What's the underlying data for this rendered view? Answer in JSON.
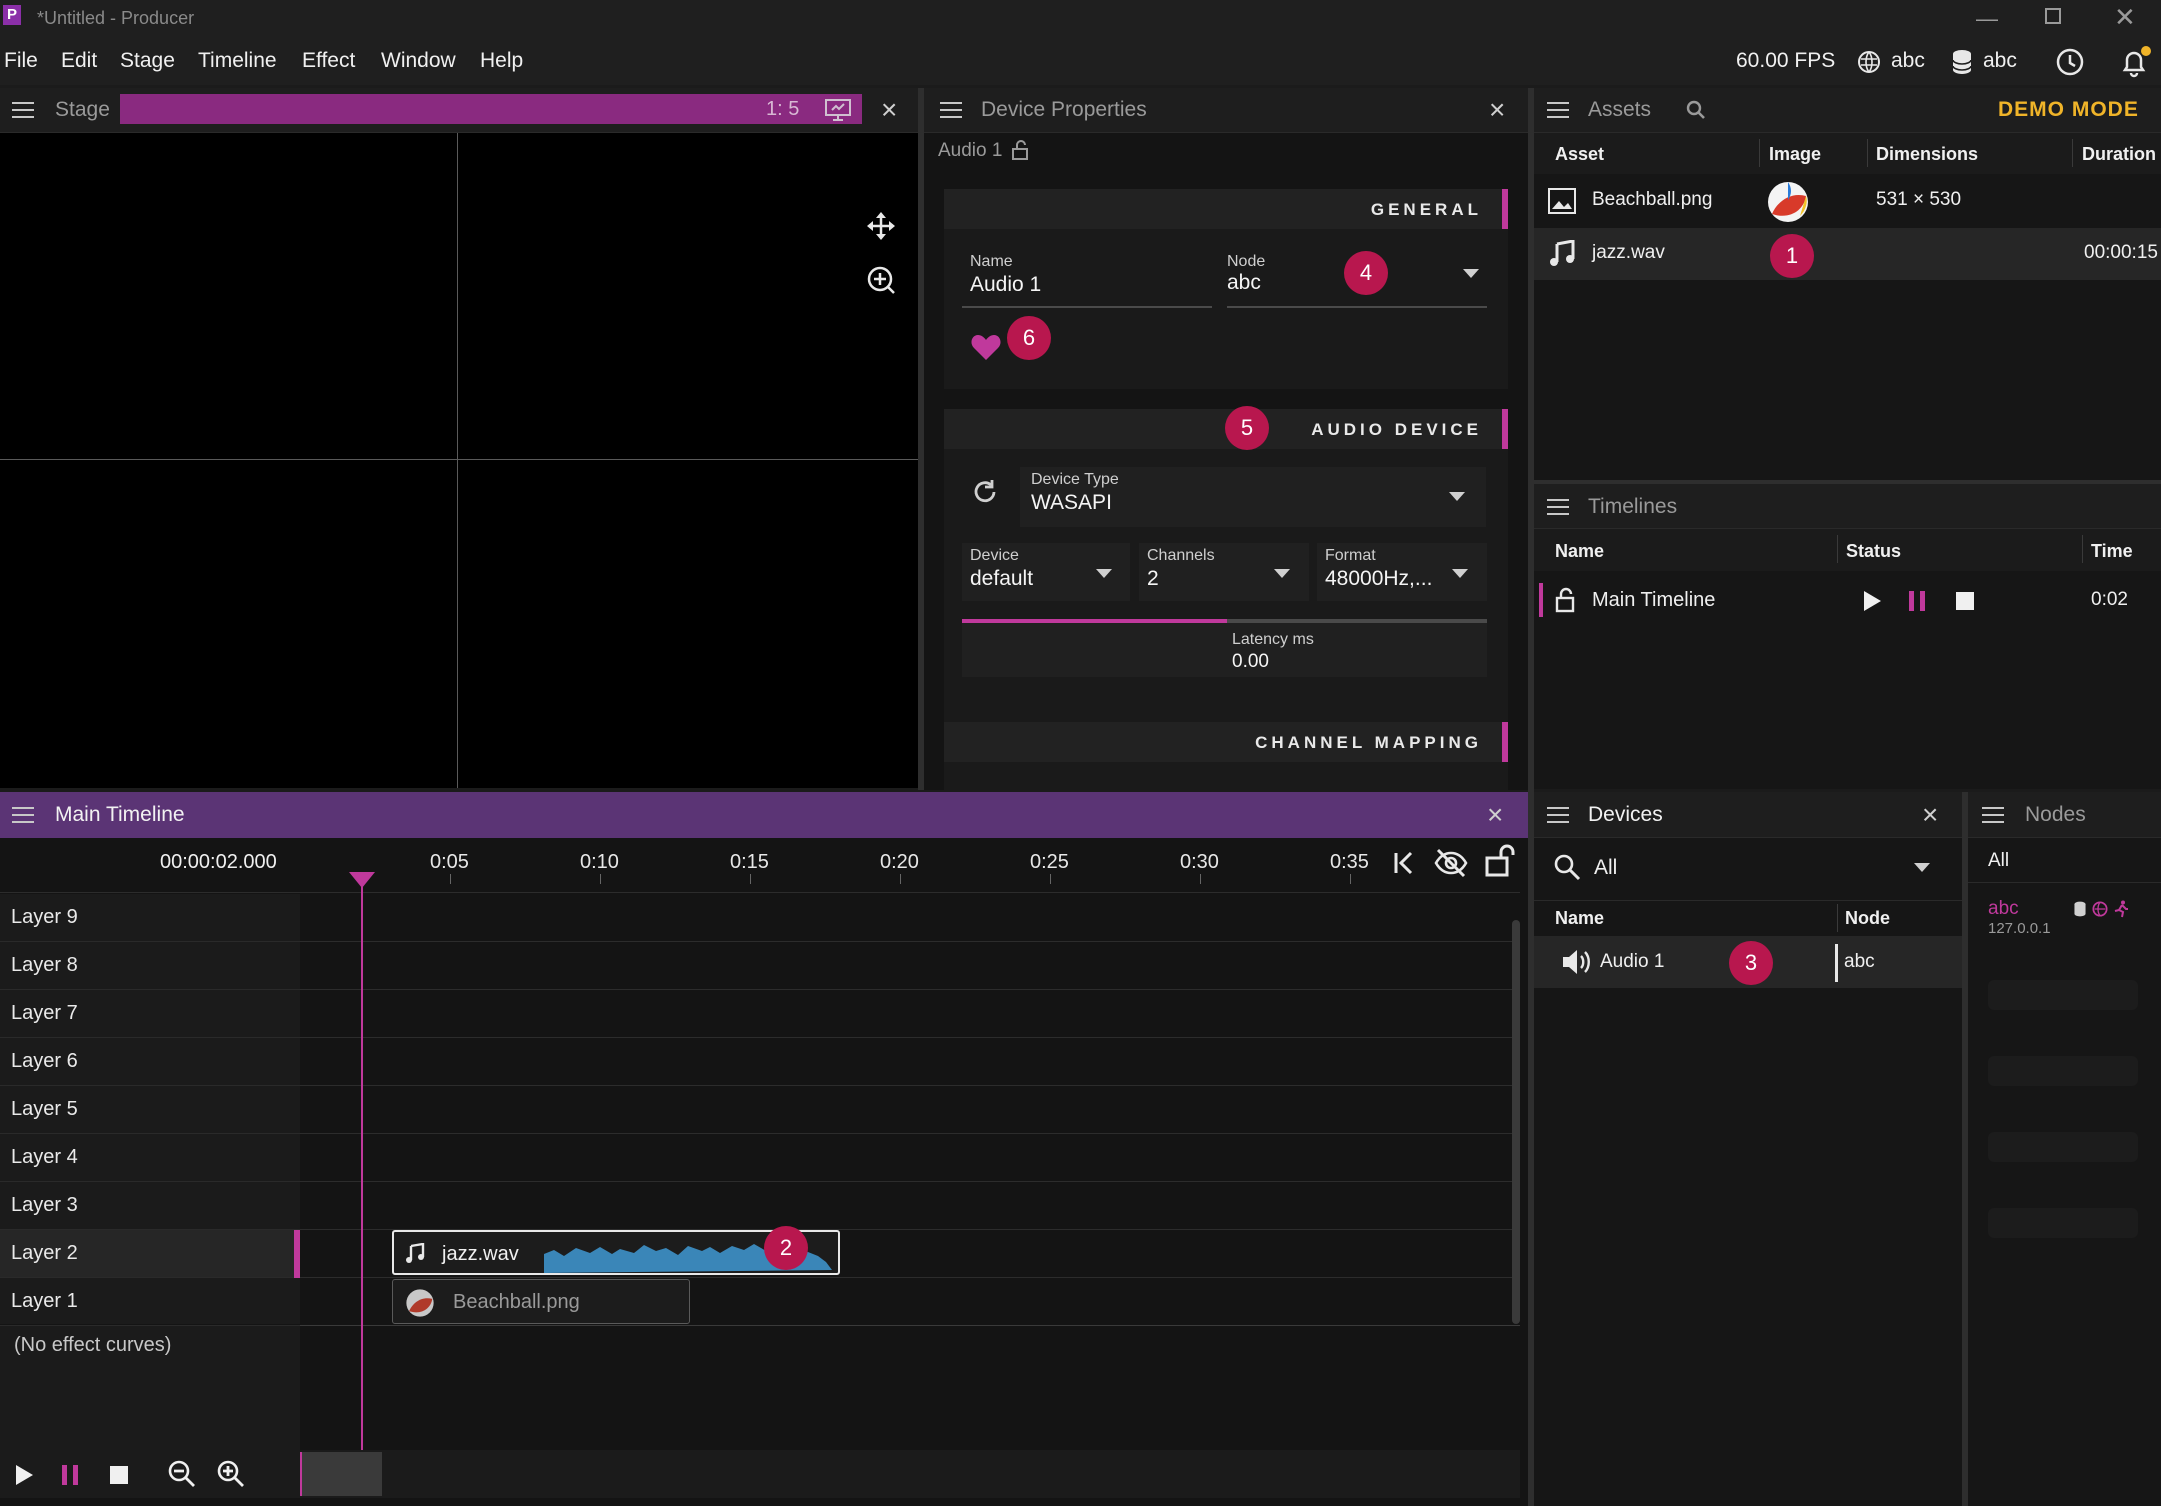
{
  "window": {
    "app_icon_letter": "P",
    "title": "*Untitled - Producer"
  },
  "menu": [
    "File",
    "Edit",
    "Stage",
    "Timeline",
    "Effect",
    "Window",
    "Help"
  ],
  "status": {
    "fps": "60.00 FPS",
    "net_node": "abc",
    "db_node": "abc"
  },
  "stage": {
    "title": "Stage",
    "ratio": "1: 5"
  },
  "device_properties": {
    "title": "Device Properties",
    "breadcrumb": "Audio 1",
    "general": {
      "header": "GENERAL",
      "name_label": "Name",
      "name_value": "Audio 1",
      "node_label": "Node",
      "node_value": "abc"
    },
    "audio_device": {
      "header": "AUDIO DEVICE",
      "device_type_label": "Device Type",
      "device_type_value": "WASAPI",
      "device_label": "Device",
      "device_value": "default",
      "channels_label": "Channels",
      "channels_value": "2",
      "format_label": "Format",
      "format_value": "48000Hz,...",
      "latency_label": "Latency ms",
      "latency_value": "0.00"
    },
    "channel_mapping": {
      "header": "CHANNEL MAPPING"
    }
  },
  "assets": {
    "title": "Assets",
    "demo_mode": "DEMO MODE",
    "columns": [
      "Asset",
      "Image",
      "Dimensions",
      "Duration"
    ],
    "rows": [
      {
        "name": "Beachball.png",
        "dimensions": "531 × 530",
        "duration": "",
        "icon": "image-icon"
      },
      {
        "name": "jazz.wav",
        "dimensions": "",
        "duration": "00:00:15",
        "icon": "music-note-icon"
      }
    ]
  },
  "timelines": {
    "title": "Timelines",
    "columns": [
      "Name",
      "Status",
      "Time"
    ],
    "rows": [
      {
        "name": "Main Timeline",
        "time": "0:02"
      }
    ]
  },
  "main_timeline": {
    "title": "Main Timeline",
    "current_time": "00:00:02.000",
    "ticks": [
      "0:05",
      "0:10",
      "0:15",
      "0:20",
      "0:25",
      "0:30",
      "0:35"
    ],
    "layers": [
      "Layer 9",
      "Layer 8",
      "Layer 7",
      "Layer 6",
      "Layer 5",
      "Layer 4",
      "Layer 3",
      "Layer 2",
      "Layer 1"
    ],
    "clips": [
      {
        "layer": "Layer 2",
        "label": "jazz.wav"
      },
      {
        "layer": "Layer 1",
        "label": "Beachball.png"
      }
    ],
    "effect_curves_text": "(No effect curves)"
  },
  "devices": {
    "title": "Devices",
    "filter": "All",
    "columns": [
      "Name",
      "Node"
    ],
    "rows": [
      {
        "name": "Audio 1",
        "node": "abc"
      }
    ]
  },
  "nodes": {
    "title": "Nodes",
    "filter": "All",
    "rows": [
      {
        "name": "abc",
        "address": "127.0.0.1"
      }
    ]
  },
  "badges": [
    "1",
    "2",
    "3",
    "4",
    "5",
    "6"
  ],
  "colors": {
    "accent": "#c0399c",
    "badge": "#b8174e",
    "demo_mode": "#f0b429",
    "timeline_header": "#5b3475"
  }
}
